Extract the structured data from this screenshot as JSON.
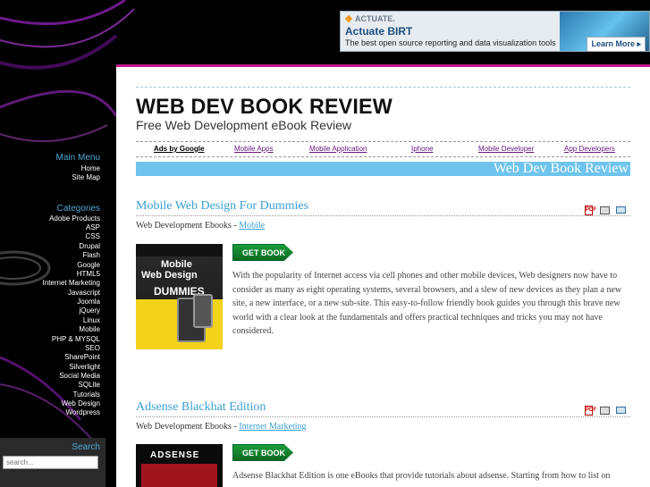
{
  "ad": {
    "brand": "ACTUATE.",
    "headline": "Actuate BIRT",
    "description": "The best open source reporting and data visualization tools",
    "cta": "Learn More ▸"
  },
  "site": {
    "title": "WEB DEV BOOK REVIEW",
    "tagline": "Free Web Development eBook Review",
    "banner": "Web Dev Book Review"
  },
  "ad_links": {
    "label": "Ads by Google",
    "items": [
      "Mobile Apps",
      "Mobile Application",
      "Iphone",
      "Mobile Developer",
      "App Developers"
    ]
  },
  "sidebar": {
    "main_menu_title": "Main Menu",
    "main_menu": [
      "Home",
      "Site Map"
    ],
    "categories_title": "Categories",
    "categories": [
      "Adobe Products",
      "ASP",
      "CSS",
      "Drupal",
      "Flash",
      "Google",
      "HTML5",
      "Internet Marketing",
      "Javascript",
      "Joomla",
      "jQuery",
      "Linux",
      "Mobile",
      "PHP & MYSQL",
      "SEO",
      "SharePoint",
      "Silverlight",
      "Social Media",
      "SQLite",
      "Tutorials",
      "Web Design",
      "Wordpress"
    ],
    "search_title": "Search",
    "search_placeholder": "search..."
  },
  "posts": [
    {
      "title": "Mobile Web Design For Dummies",
      "meta_prefix": "Web Development Ebooks - ",
      "category": "Mobile",
      "button": "GET BOOK",
      "cover_line1": "Mobile",
      "cover_line2": "Web Design",
      "cover_line3": "DUMMIES",
      "body": "With the popularity of Internet access via cell phones and other mobile devices, Web designers now have to consider as many as eight operating systems, several browsers, and a slew of new devices as they plan a new site, a new interface, or a new sub-site. This easy-to-follow friendly book guides you through this brave new world with a clear look at the fundamentals and offers practical techniques and tricks you may not have considered."
    },
    {
      "title": "Adsense Blackhat Edition",
      "meta_prefix": "Web Development Ebooks - ",
      "category": "Internet Marketing",
      "button": "GET BOOK",
      "cover_line1": "ADSENSE",
      "body": "Adsense Blackhat Edition is one eBooks that provide tutorials about adsense. Starting from how to list on"
    }
  ],
  "icons": {
    "pdf": "PDF"
  }
}
